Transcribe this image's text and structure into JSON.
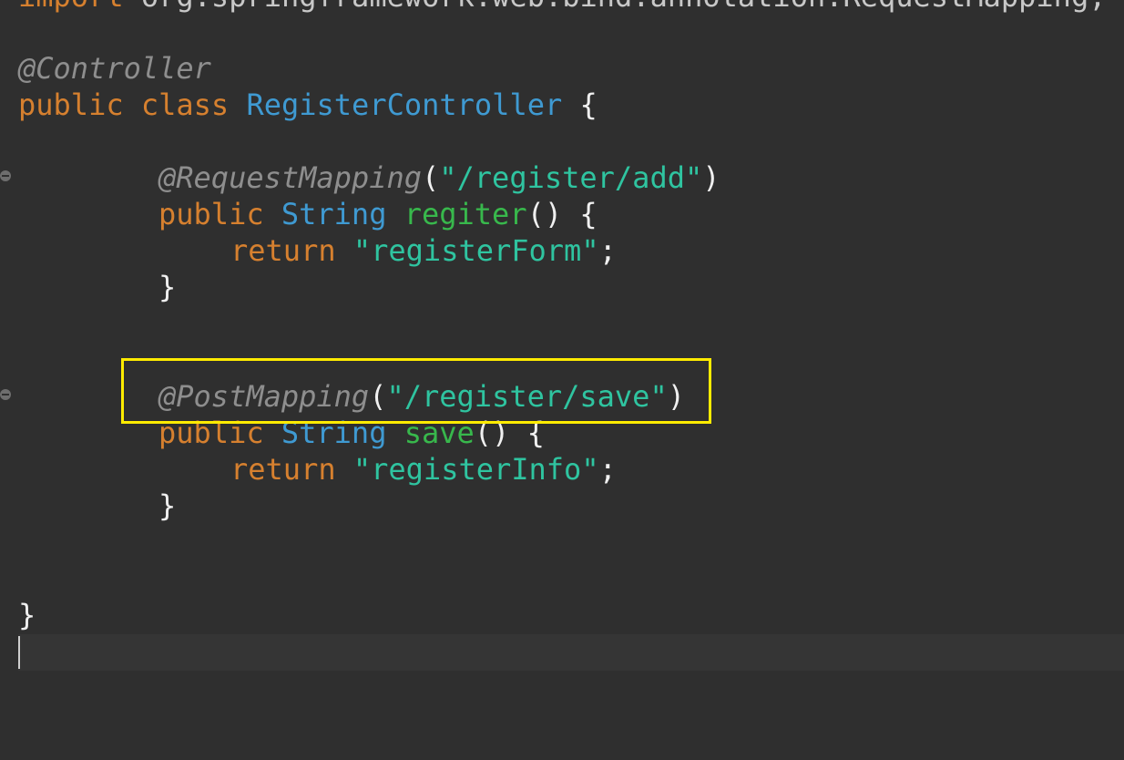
{
  "code": {
    "import_line": {
      "keyword": "import",
      "package": " org.springframework.web.bind.annotation.RequestMapping;"
    },
    "class_annotation": "@Controller",
    "class_decl": {
      "modifier": "public",
      "keyword": "class",
      "name": "RegisterController",
      "brace": " {"
    },
    "method1": {
      "annotation": "@RequestMapping",
      "open_paren": "(",
      "path": "\"/register/add\"",
      "close_paren": ")",
      "modifier": "public",
      "return_type": "String",
      "name": "regiter",
      "signature_tail": "() {",
      "return_keyword": "return",
      "return_value": "\"registerForm\"",
      "semicolon": ";",
      "close_brace": "}"
    },
    "method2": {
      "annotation": "@PostMapping",
      "open_paren": "(",
      "path": "\"/register/save\"",
      "close_paren": ")",
      "modifier": "public",
      "return_type": "String",
      "name": "save",
      "signature_tail": "() {",
      "return_keyword": "return",
      "return_value": "\"registerInfo\"",
      "semicolon": ";",
      "close_brace": "}"
    },
    "class_close": "}"
  },
  "icons": {
    "fold_marker": "collapse-fold-icon"
  },
  "colors": {
    "background": "#2f2f2f",
    "keyword": "#d6802f",
    "type": "#3f9ad2",
    "string": "#2fc4a0",
    "annotation": "#8e8e8e",
    "method": "#38b84c",
    "highlight": "#ffeb00"
  }
}
